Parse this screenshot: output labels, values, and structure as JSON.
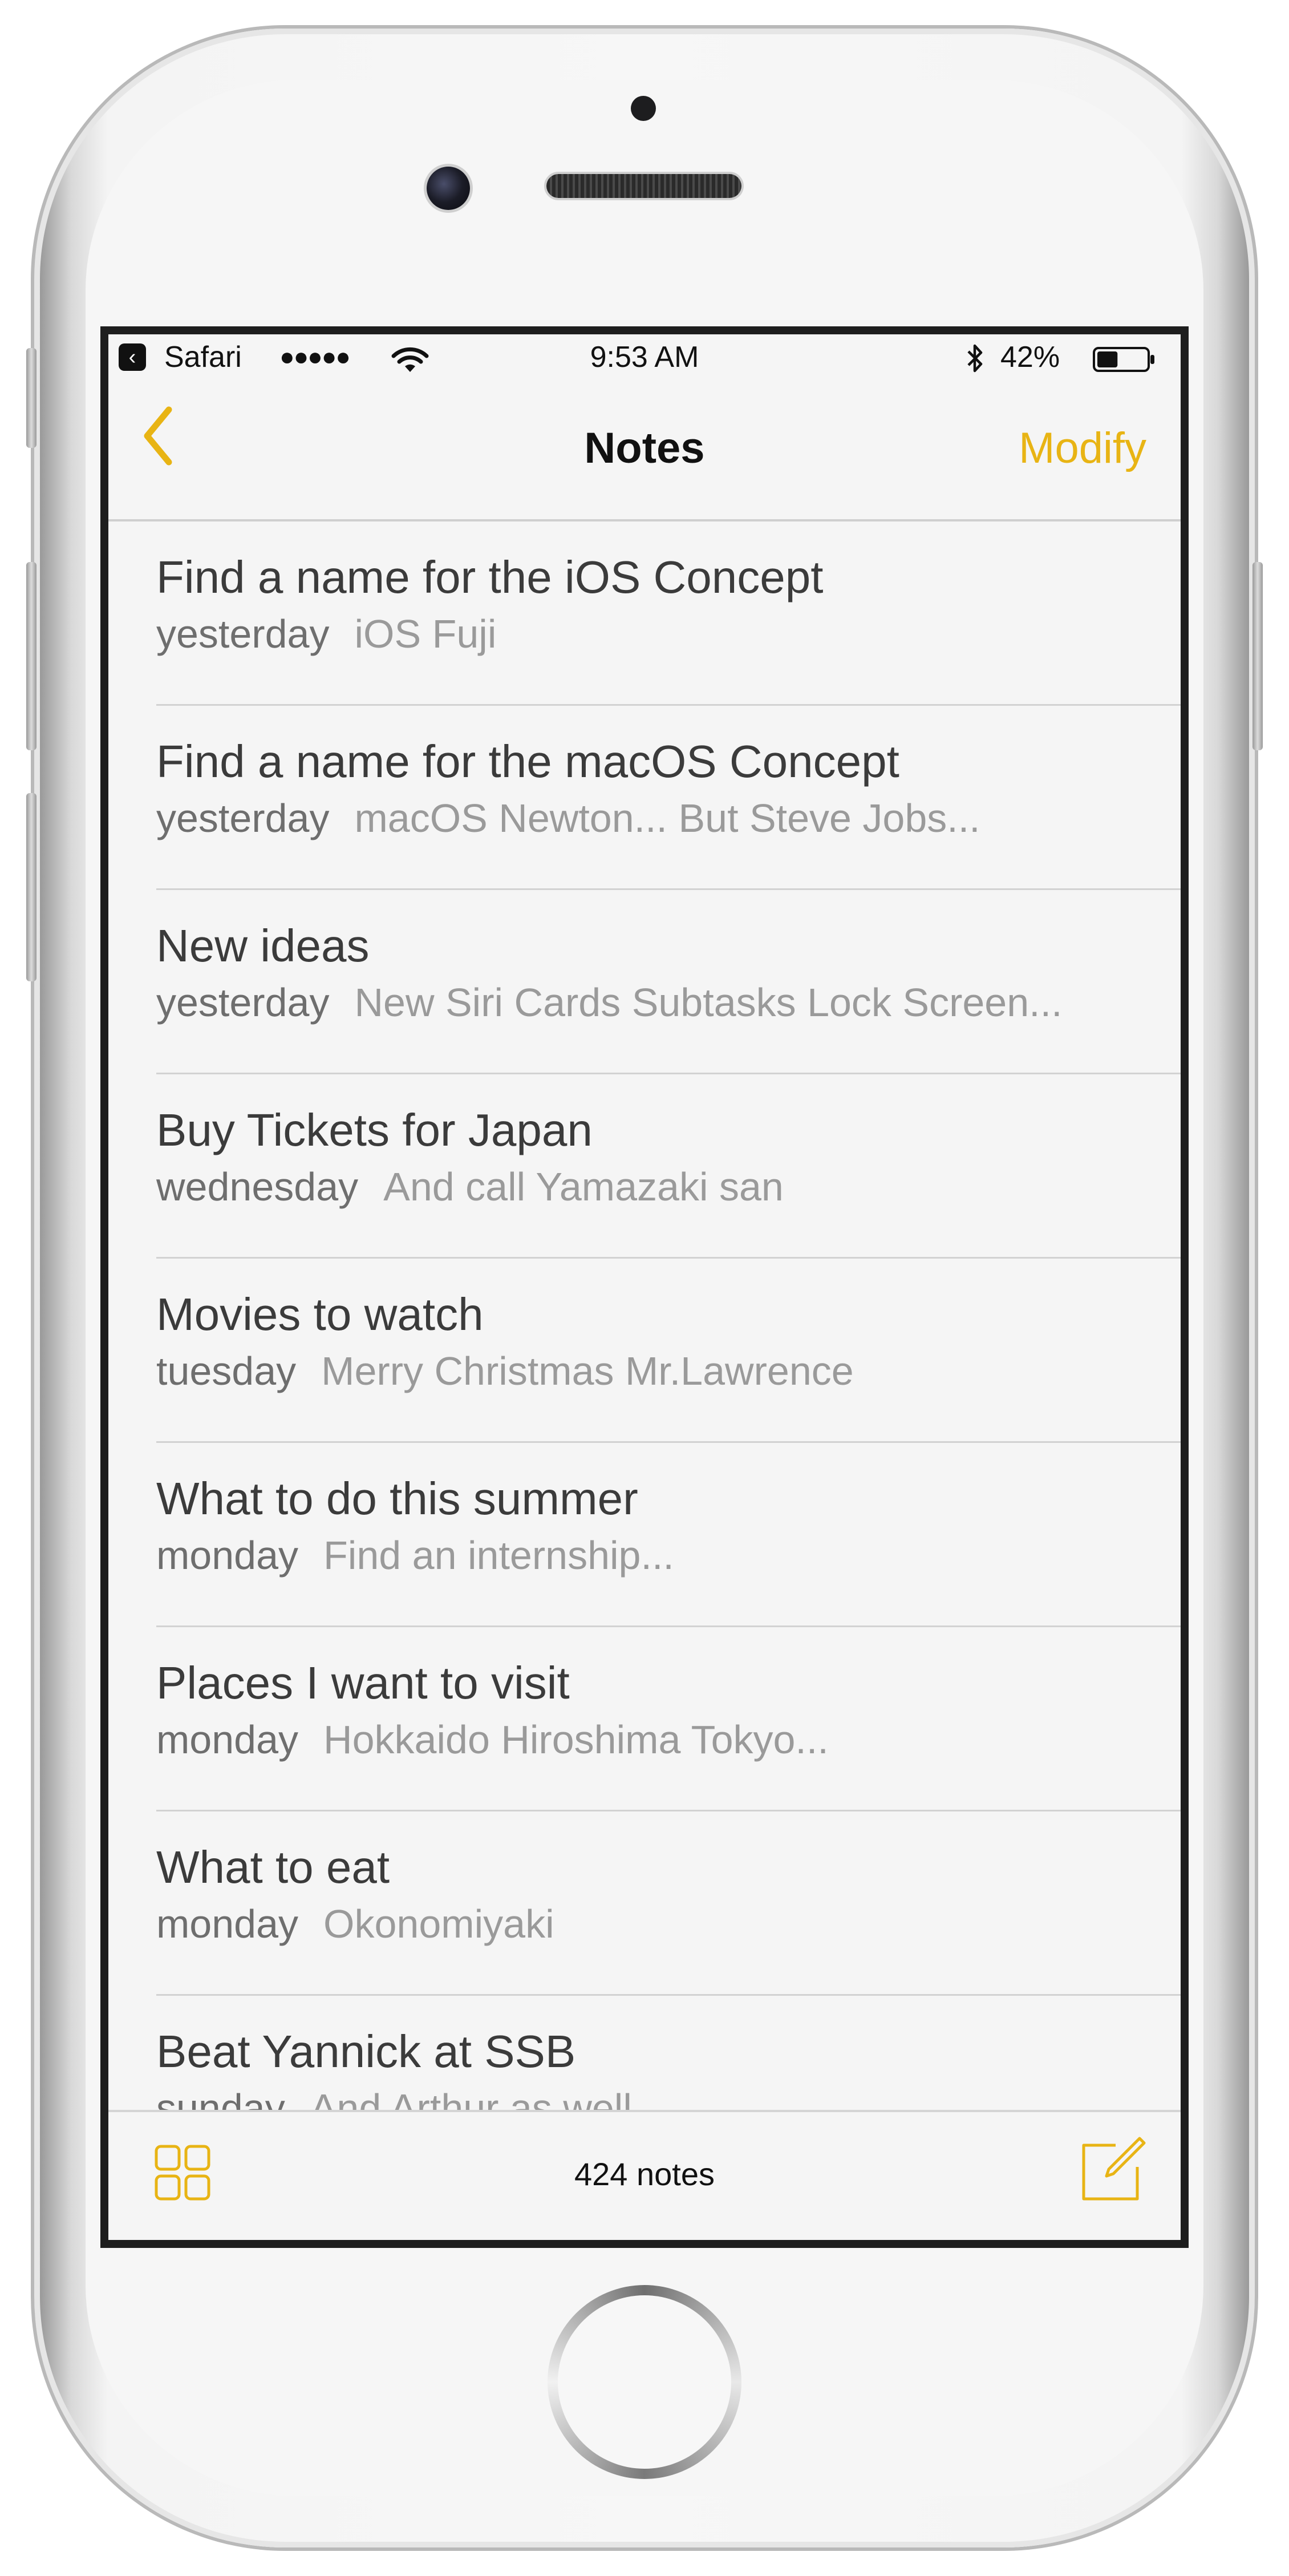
{
  "status_bar": {
    "back_app": "Safari",
    "signal": "●●●●●",
    "time": "9:53 AM",
    "battery_percent": "42%",
    "battery_level": 0.42
  },
  "nav": {
    "title": "Notes",
    "modify_label": "Modify"
  },
  "notes": [
    {
      "title": "Find a name for the iOS Concept",
      "date": "yesterday",
      "preview": "iOS Fuji"
    },
    {
      "title": "Find a name for the macOS Concept",
      "date": "yesterday",
      "preview": "macOS Newton... But Steve Jobs..."
    },
    {
      "title": "New ideas",
      "date": "yesterday",
      "preview": "New Siri Cards Subtasks Lock Screen..."
    },
    {
      "title": "Buy Tickets for Japan",
      "date": "wednesday",
      "preview": "And call Yamazaki san"
    },
    {
      "title": "Movies to watch",
      "date": "tuesday",
      "preview": "Merry Christmas Mr.Lawrence"
    },
    {
      "title": "What to do this summer",
      "date": "monday",
      "preview": "Find an internship..."
    },
    {
      "title": "Places I want to visit",
      "date": "monday",
      "preview": "Hokkaido Hiroshima Tokyo..."
    },
    {
      "title": "What to eat",
      "date": "monday",
      "preview": "Okonomiyaki"
    },
    {
      "title": "Beat Yannick at SSB",
      "date": "sunday",
      "preview": "And Arthur as well"
    }
  ],
  "toolbar": {
    "notes_count": "424 notes"
  },
  "colors": {
    "accent": "#e8b414",
    "title_text": "#3b3b3b",
    "date_text": "#6e6e6e",
    "preview_text": "#9a9a9a"
  },
  "icons": {
    "back_app": "back-to-app-icon",
    "wifi": "wifi-icon",
    "bluetooth": "bluetooth-icon",
    "battery": "battery-icon",
    "back": "chevron-left-icon",
    "gallery": "grid-icon",
    "compose": "compose-icon"
  }
}
